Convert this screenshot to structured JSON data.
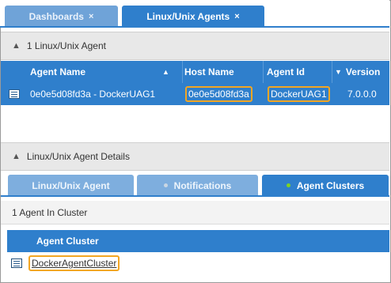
{
  "top_tabs": [
    {
      "label": "Dashboards",
      "close": "×"
    },
    {
      "label": "Linux/Unix Agents",
      "close": "×"
    }
  ],
  "agents_section": {
    "title": "1 Linux/Unix Agent",
    "columns": [
      "Agent Name",
      "Host Name",
      "Agent Id",
      "Version"
    ],
    "rows": [
      {
        "agent_name": "0e0e5d08fd3a - DockerUAG1",
        "host_name": "0e0e5d08fd3a",
        "agent_id": "DockerUAG1",
        "version": "7.0.0.0"
      }
    ]
  },
  "details_section": {
    "title": "Linux/Unix Agent Details",
    "tabs": [
      "Linux/Unix Agent",
      "Notifications",
      "Agent Clusters"
    ]
  },
  "clusters": {
    "count_text": "1 Agent In Cluster",
    "column": "Agent Cluster",
    "rows": [
      "DockerAgentCluster"
    ]
  },
  "colors": {
    "accent": "#2f7fcc",
    "highlight": "#f2a623",
    "active_dot": "#7ed321"
  }
}
